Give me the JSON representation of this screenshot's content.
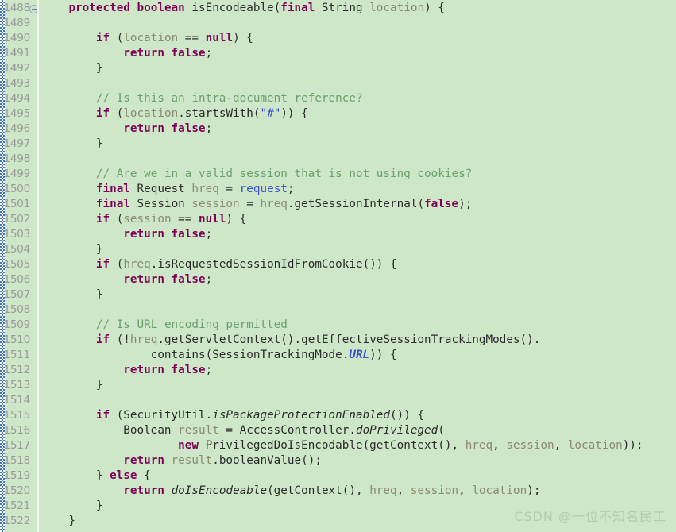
{
  "editor": {
    "language": "java",
    "background_color": "#cde7c8",
    "gutter_color": "#cde7c8",
    "line_number_color": "#9a9a9a",
    "first_line": 1488,
    "last_line": 1522,
    "fold_marker_line": 1488,
    "fold_marker_icon": "collapse-minus-circle-icon"
  },
  "colors": {
    "keyword": "#7f0055",
    "comment": "#6ba06b",
    "string": "#2a3cc8",
    "field": "#3a52c8",
    "local_variable": "#8a8a6e",
    "plain": "#2b2b2b"
  },
  "watermark": {
    "text": "CSDN @一位不知名民工"
  },
  "lines": [
    {
      "n": 1488,
      "fold": true,
      "tokens": [
        {
          "t": "    ",
          "c": "plain"
        },
        {
          "t": "protected boolean ",
          "c": "kw"
        },
        {
          "t": "isEncodeable(",
          "c": "plain"
        },
        {
          "t": "final",
          "c": "kw"
        },
        {
          "t": " String ",
          "c": "plain"
        },
        {
          "t": "location",
          "c": "local"
        },
        {
          "t": ") {",
          "c": "plain"
        }
      ]
    },
    {
      "n": 1489,
      "tokens": []
    },
    {
      "n": 1490,
      "tokens": [
        {
          "t": "        ",
          "c": "plain"
        },
        {
          "t": "if",
          "c": "kw"
        },
        {
          "t": " (",
          "c": "plain"
        },
        {
          "t": "location",
          "c": "local"
        },
        {
          "t": " == ",
          "c": "plain"
        },
        {
          "t": "null",
          "c": "kw"
        },
        {
          "t": ") {",
          "c": "plain"
        }
      ]
    },
    {
      "n": 1491,
      "tokens": [
        {
          "t": "            ",
          "c": "plain"
        },
        {
          "t": "return false",
          "c": "kw"
        },
        {
          "t": ";",
          "c": "plain"
        }
      ]
    },
    {
      "n": 1492,
      "tokens": [
        {
          "t": "        }",
          "c": "plain"
        }
      ]
    },
    {
      "n": 1493,
      "tokens": []
    },
    {
      "n": 1494,
      "tokens": [
        {
          "t": "        ",
          "c": "plain"
        },
        {
          "t": "// Is this an intra-document reference?",
          "c": "cmt"
        }
      ]
    },
    {
      "n": 1495,
      "tokens": [
        {
          "t": "        ",
          "c": "plain"
        },
        {
          "t": "if",
          "c": "kw"
        },
        {
          "t": " (",
          "c": "plain"
        },
        {
          "t": "location",
          "c": "local"
        },
        {
          "t": ".startsWith(",
          "c": "plain"
        },
        {
          "t": "\"#\"",
          "c": "str"
        },
        {
          "t": ")) {",
          "c": "plain"
        }
      ]
    },
    {
      "n": 1496,
      "tokens": [
        {
          "t": "            ",
          "c": "plain"
        },
        {
          "t": "return false",
          "c": "kw"
        },
        {
          "t": ";",
          "c": "plain"
        }
      ]
    },
    {
      "n": 1497,
      "tokens": [
        {
          "t": "        }",
          "c": "plain"
        }
      ]
    },
    {
      "n": 1498,
      "tokens": []
    },
    {
      "n": 1499,
      "tokens": [
        {
          "t": "        ",
          "c": "plain"
        },
        {
          "t": "// Are we in a valid session that is not using cookies?",
          "c": "cmt"
        }
      ]
    },
    {
      "n": 1500,
      "tokens": [
        {
          "t": "        ",
          "c": "plain"
        },
        {
          "t": "final",
          "c": "kw"
        },
        {
          "t": " Request ",
          "c": "plain"
        },
        {
          "t": "hreq",
          "c": "local"
        },
        {
          "t": " = ",
          "c": "plain"
        },
        {
          "t": "request",
          "c": "field"
        },
        {
          "t": ";",
          "c": "plain"
        }
      ]
    },
    {
      "n": 1501,
      "tokens": [
        {
          "t": "        ",
          "c": "plain"
        },
        {
          "t": "final",
          "c": "kw"
        },
        {
          "t": " Session ",
          "c": "plain"
        },
        {
          "t": "session",
          "c": "local"
        },
        {
          "t": " = ",
          "c": "plain"
        },
        {
          "t": "hreq",
          "c": "local"
        },
        {
          "t": ".getSessionInternal(",
          "c": "plain"
        },
        {
          "t": "false",
          "c": "kw"
        },
        {
          "t": ");",
          "c": "plain"
        }
      ]
    },
    {
      "n": 1502,
      "tokens": [
        {
          "t": "        ",
          "c": "plain"
        },
        {
          "t": "if",
          "c": "kw"
        },
        {
          "t": " (",
          "c": "plain"
        },
        {
          "t": "session",
          "c": "local"
        },
        {
          "t": " == ",
          "c": "plain"
        },
        {
          "t": "null",
          "c": "kw"
        },
        {
          "t": ") {",
          "c": "plain"
        }
      ]
    },
    {
      "n": 1503,
      "tokens": [
        {
          "t": "            ",
          "c": "plain"
        },
        {
          "t": "return false",
          "c": "kw"
        },
        {
          "t": ";",
          "c": "plain"
        }
      ]
    },
    {
      "n": 1504,
      "tokens": [
        {
          "t": "        }",
          "c": "plain"
        }
      ]
    },
    {
      "n": 1505,
      "tokens": [
        {
          "t": "        ",
          "c": "plain"
        },
        {
          "t": "if",
          "c": "kw"
        },
        {
          "t": " (",
          "c": "plain"
        },
        {
          "t": "hreq",
          "c": "local"
        },
        {
          "t": ".isRequestedSessionIdFromCookie()) {",
          "c": "plain"
        }
      ]
    },
    {
      "n": 1506,
      "tokens": [
        {
          "t": "            ",
          "c": "plain"
        },
        {
          "t": "return false",
          "c": "kw"
        },
        {
          "t": ";",
          "c": "plain"
        }
      ]
    },
    {
      "n": 1507,
      "tokens": [
        {
          "t": "        }",
          "c": "plain"
        }
      ]
    },
    {
      "n": 1508,
      "tokens": []
    },
    {
      "n": 1509,
      "tokens": [
        {
          "t": "        ",
          "c": "plain"
        },
        {
          "t": "// Is URL encoding permitted",
          "c": "cmt"
        }
      ]
    },
    {
      "n": 1510,
      "tokens": [
        {
          "t": "        ",
          "c": "plain"
        },
        {
          "t": "if",
          "c": "kw"
        },
        {
          "t": " (!",
          "c": "plain"
        },
        {
          "t": "hreq",
          "c": "local"
        },
        {
          "t": ".getServletContext().getEffectiveSessionTrackingModes().",
          "c": "plain"
        }
      ]
    },
    {
      "n": 1511,
      "tokens": [
        {
          "t": "                contains(SessionTrackingMode.",
          "c": "plain"
        },
        {
          "t": "URL",
          "c": "sfield"
        },
        {
          "t": ")) {",
          "c": "plain"
        }
      ]
    },
    {
      "n": 1512,
      "tokens": [
        {
          "t": "            ",
          "c": "plain"
        },
        {
          "t": "return false",
          "c": "kw"
        },
        {
          "t": ";",
          "c": "plain"
        }
      ]
    },
    {
      "n": 1513,
      "tokens": [
        {
          "t": "        }",
          "c": "plain"
        }
      ]
    },
    {
      "n": 1514,
      "tokens": []
    },
    {
      "n": 1515,
      "tokens": [
        {
          "t": "        ",
          "c": "plain"
        },
        {
          "t": "if",
          "c": "kw"
        },
        {
          "t": " (SecurityUtil.",
          "c": "plain"
        },
        {
          "t": "isPackageProtectionEnabled",
          "c": "smeth"
        },
        {
          "t": "()) {",
          "c": "plain"
        }
      ]
    },
    {
      "n": 1516,
      "tokens": [
        {
          "t": "            Boolean ",
          "c": "plain"
        },
        {
          "t": "result",
          "c": "local"
        },
        {
          "t": " = AccessController.",
          "c": "plain"
        },
        {
          "t": "doPrivileged",
          "c": "smeth"
        },
        {
          "t": "(",
          "c": "plain"
        }
      ]
    },
    {
      "n": 1517,
      "tokens": [
        {
          "t": "                    ",
          "c": "plain"
        },
        {
          "t": "new",
          "c": "kw"
        },
        {
          "t": " PrivilegedDoIsEncodable(getContext(), ",
          "c": "plain"
        },
        {
          "t": "hreq",
          "c": "local"
        },
        {
          "t": ", ",
          "c": "plain"
        },
        {
          "t": "session",
          "c": "local"
        },
        {
          "t": ", ",
          "c": "plain"
        },
        {
          "t": "location",
          "c": "local"
        },
        {
          "t": "));",
          "c": "plain"
        }
      ]
    },
    {
      "n": 1518,
      "tokens": [
        {
          "t": "            ",
          "c": "plain"
        },
        {
          "t": "return",
          "c": "kw"
        },
        {
          "t": " ",
          "c": "plain"
        },
        {
          "t": "result",
          "c": "local"
        },
        {
          "t": ".booleanValue();",
          "c": "plain"
        }
      ]
    },
    {
      "n": 1519,
      "tokens": [
        {
          "t": "        } ",
          "c": "plain"
        },
        {
          "t": "else",
          "c": "kw"
        },
        {
          "t": " {",
          "c": "plain"
        }
      ]
    },
    {
      "n": 1520,
      "tokens": [
        {
          "t": "            ",
          "c": "plain"
        },
        {
          "t": "return",
          "c": "kw"
        },
        {
          "t": " ",
          "c": "plain"
        },
        {
          "t": "doIsEncodeable",
          "c": "smeth"
        },
        {
          "t": "(getContext(), ",
          "c": "plain"
        },
        {
          "t": "hreq",
          "c": "local"
        },
        {
          "t": ", ",
          "c": "plain"
        },
        {
          "t": "session",
          "c": "local"
        },
        {
          "t": ", ",
          "c": "plain"
        },
        {
          "t": "location",
          "c": "local"
        },
        {
          "t": ");",
          "c": "plain"
        }
      ]
    },
    {
      "n": 1521,
      "tokens": [
        {
          "t": "        }",
          "c": "plain"
        }
      ]
    },
    {
      "n": 1522,
      "tokens": [
        {
          "t": "    }",
          "c": "plain"
        }
      ]
    }
  ]
}
